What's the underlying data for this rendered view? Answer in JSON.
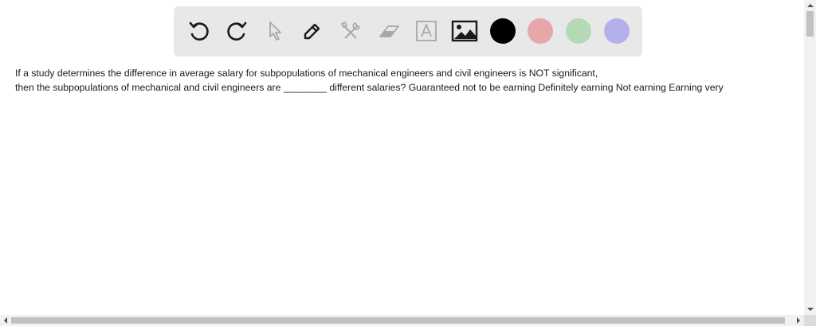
{
  "toolbar": {
    "tools": [
      {
        "name": "undo-icon",
        "enabled": true
      },
      {
        "name": "redo-icon",
        "enabled": true
      },
      {
        "name": "pointer-icon",
        "enabled": false
      },
      {
        "name": "pen-icon",
        "enabled": true
      },
      {
        "name": "tools-icon",
        "enabled": false
      },
      {
        "name": "eraser-icon",
        "enabled": false
      },
      {
        "name": "text-icon",
        "enabled": false
      },
      {
        "name": "image-icon",
        "enabled": true
      }
    ],
    "colors": {
      "black": "#000000",
      "red": "#e8a6ab",
      "green": "#b4dab5",
      "purple": "#b4b0ea"
    },
    "icon_color": "#1a1a1a",
    "disabled_icon_color": "#a8a8a8",
    "background": "#e8e8e8"
  },
  "question": {
    "line1": "If a study determines the difference in average salary for subpopulations of mechanical engineers and civil engineers is NOT significant,",
    "line2": "then the subpopulations of mechanical and civil engineers are ________ different salaries? Guaranteed not to be earning Definitely earning Not earning Earning very"
  }
}
